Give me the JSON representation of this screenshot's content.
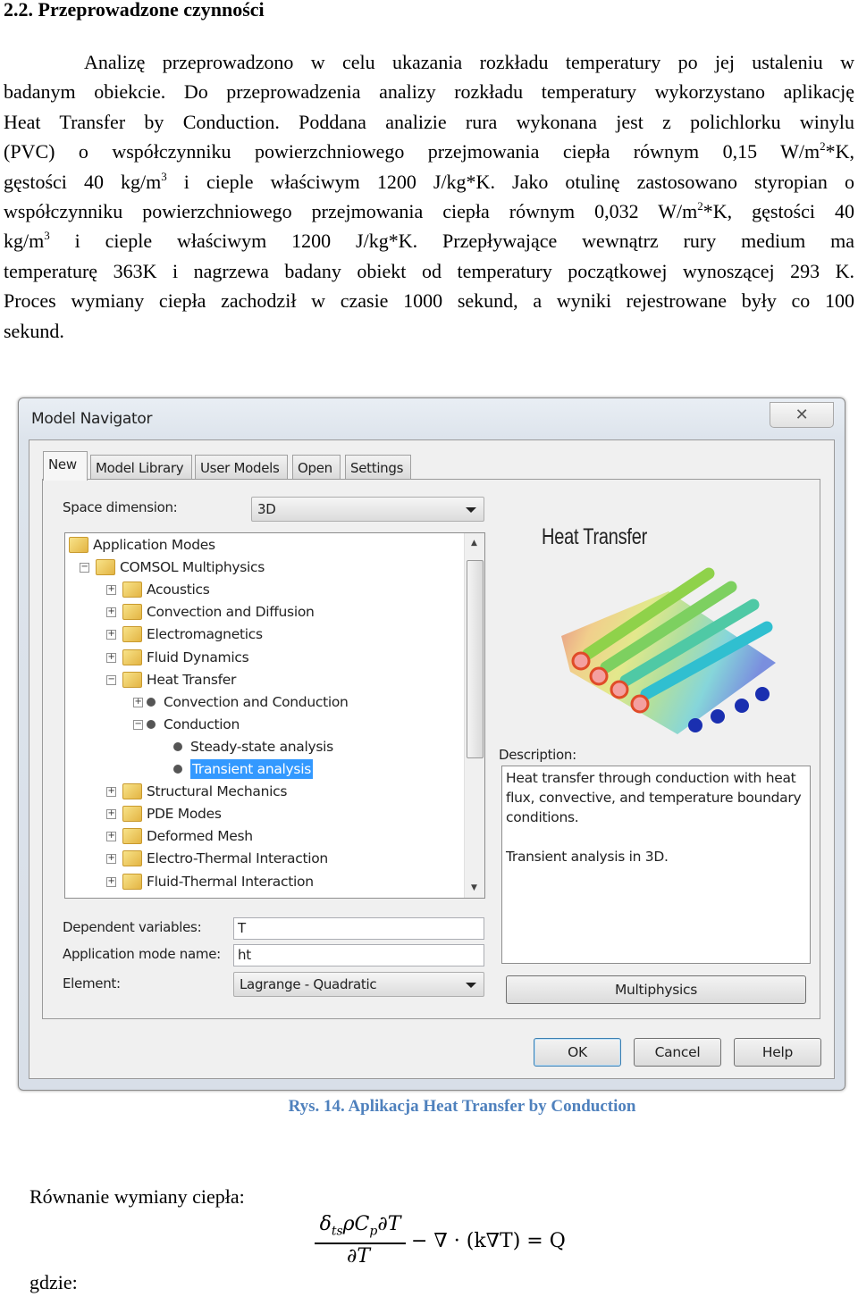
{
  "heading": "2.2. Przeprowadzone czynności",
  "paragraph": {
    "l1": "Analizę przeprowadzono w celu ukazania rozkładu temperatury po jej ustaleniu w",
    "l2": "badanym obiekcie. Do przeprowadzenia analizy rozkładu temperatury wykorzystano aplikację",
    "l3": "Heat Transfer by Conduction. Poddana analizie rura wykonana jest z polichlorku winylu",
    "l4a": "(PVC) o współczynniku powierzchniowego przejmowania ciepła równym 0,15 W/m",
    "l4sup": "2",
    "l4b": "*K,",
    "l5a": "gęstości 40 kg/m",
    "l5sup": "3",
    "l5b": " i cieple właściwym 1200 J/kg*K. Jako otulinę zastosowano styropian o",
    "l6a": "współczynniku powierzchniowego przejmowania ciepła równym 0,032 W/m",
    "l6sup": "2",
    "l6b": "*K, gęstości 40",
    "l7a": "kg/m",
    "l7sup": "3",
    "l7b": " i cieple właściwym 1200 J/kg*K. Przepływające wewnątrz rury medium ma",
    "l8": "temperaturę 363K i nagrzewa badany obiekt od temperatury początkowej wynoszącej 293 K.",
    "l9": "Proces wymiany ciepła zachodził w czasie 1000 sekund, a wyniki rejestrowane były co 100",
    "l10": "sekund."
  },
  "dialog": {
    "title": "Model Navigator",
    "close_icon": "close-icon",
    "tabs": [
      "New",
      "Model Library",
      "User Models",
      "Open",
      "Settings"
    ],
    "active_tab": "New",
    "space_dimension_label": "Space dimension:",
    "space_dimension_value": "3D",
    "tree": [
      {
        "label": "Application Modes",
        "level": 0,
        "icon": "folder"
      },
      {
        "label": "COMSOL Multiphysics",
        "level": 1,
        "icon": "folder",
        "expander": "minus"
      },
      {
        "label": "Acoustics",
        "level": 2,
        "icon": "folder",
        "expander": "plus"
      },
      {
        "label": "Convection and Diffusion",
        "level": 2,
        "icon": "folder",
        "expander": "plus"
      },
      {
        "label": "Electromagnetics",
        "level": 2,
        "icon": "folder",
        "expander": "plus"
      },
      {
        "label": "Fluid Dynamics",
        "level": 2,
        "icon": "folder",
        "expander": "plus"
      },
      {
        "label": "Heat Transfer",
        "level": 2,
        "icon": "folder",
        "expander": "minus"
      },
      {
        "label": "Convection and Conduction",
        "level": 3,
        "icon": "bullet",
        "expander": "plus"
      },
      {
        "label": "Conduction",
        "level": 3,
        "icon": "bullet",
        "expander": "minus"
      },
      {
        "label": "Steady-state analysis",
        "level": 4,
        "icon": "bullet"
      },
      {
        "label": "Transient analysis",
        "level": 4,
        "icon": "bullet",
        "selected": true
      },
      {
        "label": "Structural Mechanics",
        "level": 2,
        "icon": "folder",
        "expander": "plus"
      },
      {
        "label": "PDE Modes",
        "level": 2,
        "icon": "folder",
        "expander": "plus"
      },
      {
        "label": "Deformed Mesh",
        "level": 2,
        "icon": "folder",
        "expander": "plus"
      },
      {
        "label": "Electro-Thermal Interaction",
        "level": 2,
        "icon": "folder",
        "expander": "plus"
      },
      {
        "label": "Fluid-Thermal Interaction",
        "level": 2,
        "icon": "folder",
        "expander": "plus"
      }
    ],
    "preview_title": "Heat Transfer",
    "description_label": "Description:",
    "description_text": "Heat transfer through conduction with heat flux, convective, and temperature boundary conditions.",
    "description_text2": "Transient analysis in 3D.",
    "dependent_variables_label": "Dependent variables:",
    "dependent_variables_value": "T",
    "application_mode_name_label": "Application mode name:",
    "application_mode_name_value": "ht",
    "element_label": "Element:",
    "element_value": "Lagrange - Quadratic",
    "multiphysics_button": "Multiphysics",
    "ok_button": "OK",
    "cancel_button": "Cancel",
    "help_button": "Help",
    "selection_color": "#3399ff"
  },
  "caption": "Rys. 14. Aplikacja Heat Transfer by Conduction",
  "equation_label": "Równanie wymiany ciepła:",
  "equation": {
    "numerator": "δtsρCp∂T",
    "denominator": "∂T",
    "rest": "− ∇ · (k∇T) = Q"
  },
  "where_label": "gdzie:"
}
